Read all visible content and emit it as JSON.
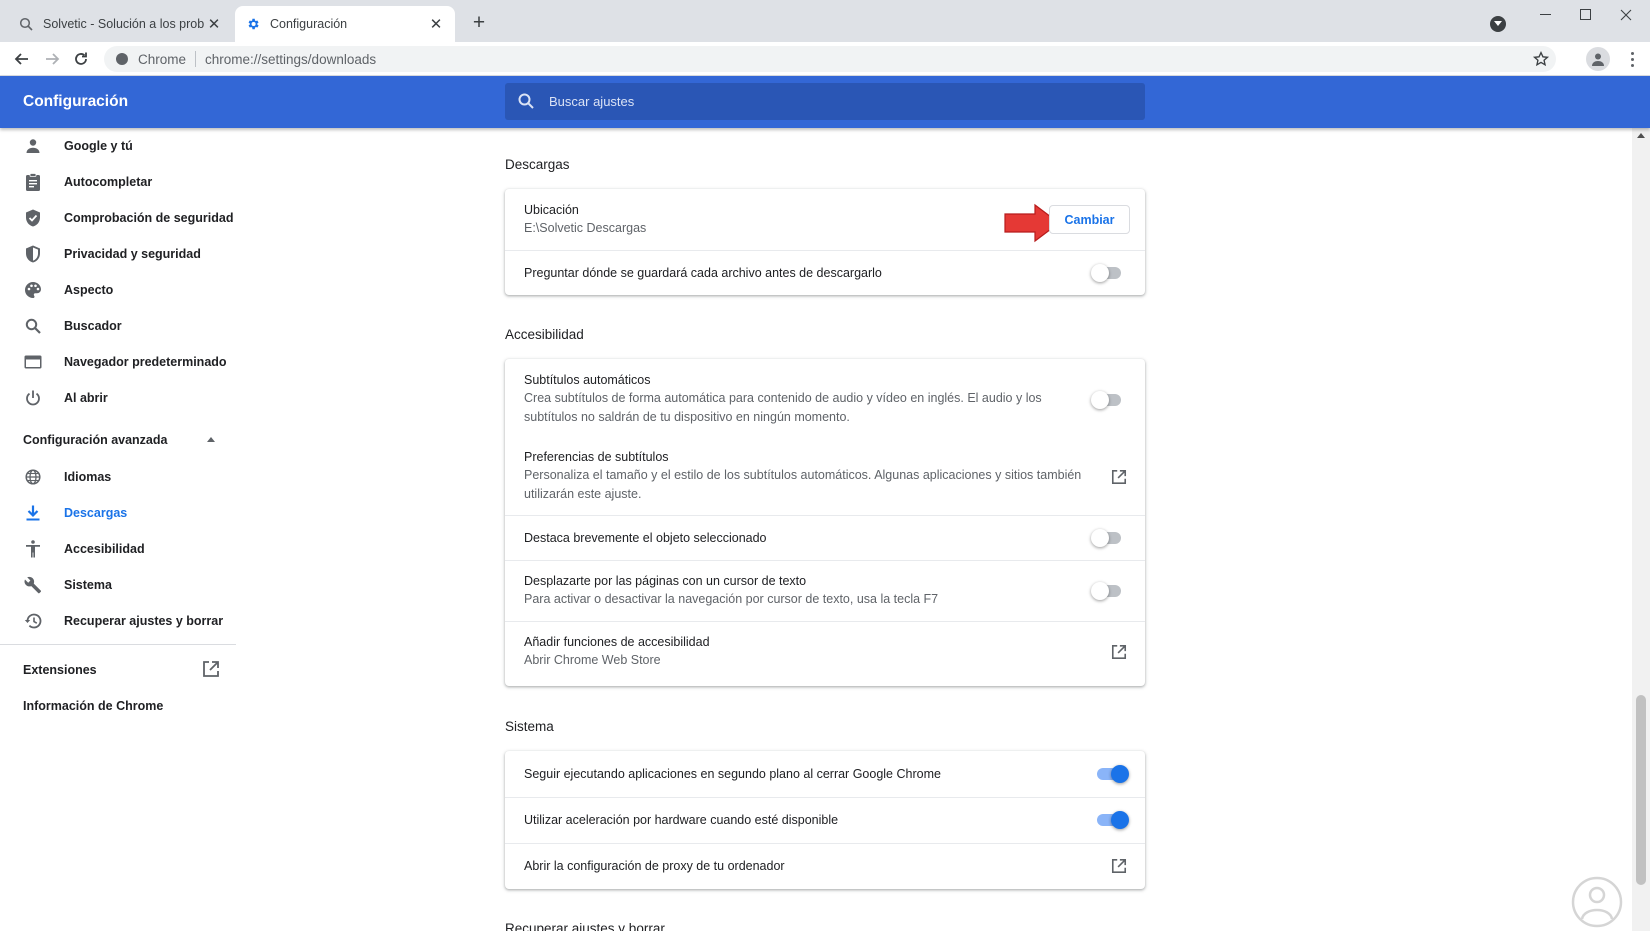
{
  "browser": {
    "tabs": [
      {
        "title": "Solvetic - Solución a los problem",
        "active": false
      },
      {
        "title": "Configuración",
        "active": true
      }
    ],
    "omnibox": {
      "chip": "Chrome",
      "url": "chrome://settings/downloads"
    }
  },
  "header": {
    "title": "Configuración",
    "search_placeholder": "Buscar ajustes"
  },
  "sidebar": {
    "items": [
      {
        "label": "Google y tú",
        "icon": "person-icon"
      },
      {
        "label": "Autocompletar",
        "icon": "clipboard-icon"
      },
      {
        "label": "Comprobación de seguridad",
        "icon": "shield-check-icon"
      },
      {
        "label": "Privacidad y seguridad",
        "icon": "shield-half-icon"
      },
      {
        "label": "Aspecto",
        "icon": "palette-icon"
      },
      {
        "label": "Buscador",
        "icon": "search-icon"
      },
      {
        "label": "Navegador predeterminado",
        "icon": "browser-window-icon"
      },
      {
        "label": "Al abrir",
        "icon": "power-icon"
      }
    ],
    "advanced_label": "Configuración avanzada",
    "advanced_items": [
      {
        "label": "Idiomas",
        "icon": "globe-icon"
      },
      {
        "label": "Descargas",
        "icon": "download-icon",
        "selected": true
      },
      {
        "label": "Accesibilidad",
        "icon": "accessibility-icon"
      },
      {
        "label": "Sistema",
        "icon": "wrench-icon"
      },
      {
        "label": "Recuperar ajustes y borrar",
        "icon": "history-icon"
      }
    ],
    "extensions_label": "Extensiones",
    "about_label": "Información de Chrome"
  },
  "sections": {
    "downloads": {
      "title": "Descargas",
      "location_label": "Ubicación",
      "location_value": "E:\\Solvetic Descargas",
      "change_button": "Cambiar",
      "ask_label": "Preguntar dónde se guardará cada archivo antes de descargarlo",
      "ask_enabled": false
    },
    "accessibility": {
      "title": "Accesibilidad",
      "captions_label": "Subtítulos automáticos",
      "captions_desc_1": "Crea subtítulos de forma automática para contenido de audio y vídeo en inglés. El audio y los",
      "captions_desc_2": "subtítulos no saldrán de tu dispositivo en ningún momento.",
      "captions_enabled": false,
      "caption_prefs_label": "Preferencias de subtítulos",
      "caption_prefs_desc_1": "Personaliza el tamaño y el estilo de los subtítulos automáticos. Algunas aplicaciones y sitios también",
      "caption_prefs_desc_2": "utilizarán este ajuste.",
      "highlight_label": "Destaca brevemente el objeto seleccionado",
      "highlight_enabled": false,
      "caret_label": "Desplazarte por las páginas con un cursor de texto",
      "caret_desc": "Para activar o desactivar la navegación por cursor de texto, usa la tecla F7",
      "caret_enabled": false,
      "add_features_label": "Añadir funciones de accesibilidad",
      "add_features_desc": "Abrir Chrome Web Store"
    },
    "system": {
      "title": "Sistema",
      "background_label": "Seguir ejecutando aplicaciones en segundo plano al cerrar Google Chrome",
      "background_enabled": true,
      "hw_accel_label": "Utilizar aceleración por hardware cuando esté disponible",
      "hw_accel_enabled": true,
      "proxy_label": "Abrir la configuración de proxy de tu ordenador"
    },
    "reset": {
      "title": "Recuperar ajustes y borrar"
    }
  },
  "colors": {
    "header": "#3367d6",
    "accent": "#1a73e8",
    "arrow": "#e53935"
  }
}
